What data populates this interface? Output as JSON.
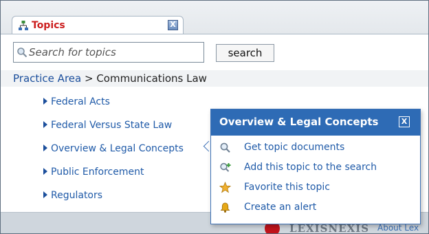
{
  "topics_tab": {
    "title": "Topics",
    "close_glyph": "X",
    "icon": "topic-tree-icon"
  },
  "search": {
    "placeholder": "Search for topics",
    "value": "",
    "button_label": "search"
  },
  "breadcrumb": {
    "root": "Practice Area",
    "separator": " > ",
    "current": "Communications Law"
  },
  "topics": [
    {
      "label": "Federal Acts"
    },
    {
      "label": "Federal Versus State Law"
    },
    {
      "label": "Overview & Legal Concepts"
    },
    {
      "label": "Public Enforcement"
    },
    {
      "label": "Regulators"
    }
  ],
  "popup": {
    "title": "Overview & Legal Concepts",
    "close_glyph": "X",
    "items": [
      {
        "label": "Get topic documents",
        "icon": "magnifier-icon"
      },
      {
        "label": "Add this topic to the search",
        "icon": "magnifier-add-icon"
      },
      {
        "label": "Favorite this topic",
        "icon": "star-icon"
      },
      {
        "label": "Create an alert",
        "icon": "bell-icon"
      }
    ]
  },
  "footer": {
    "brand": "LEXISNEXIS",
    "link": "About Lex"
  },
  "colors": {
    "tab_title": "#cc1f1f",
    "link_blue": "#1f5aa8",
    "popup_header": "#2e6bb5",
    "star": "#f0b030",
    "bell": "#e6a817",
    "logo_red": "#c0131b"
  }
}
